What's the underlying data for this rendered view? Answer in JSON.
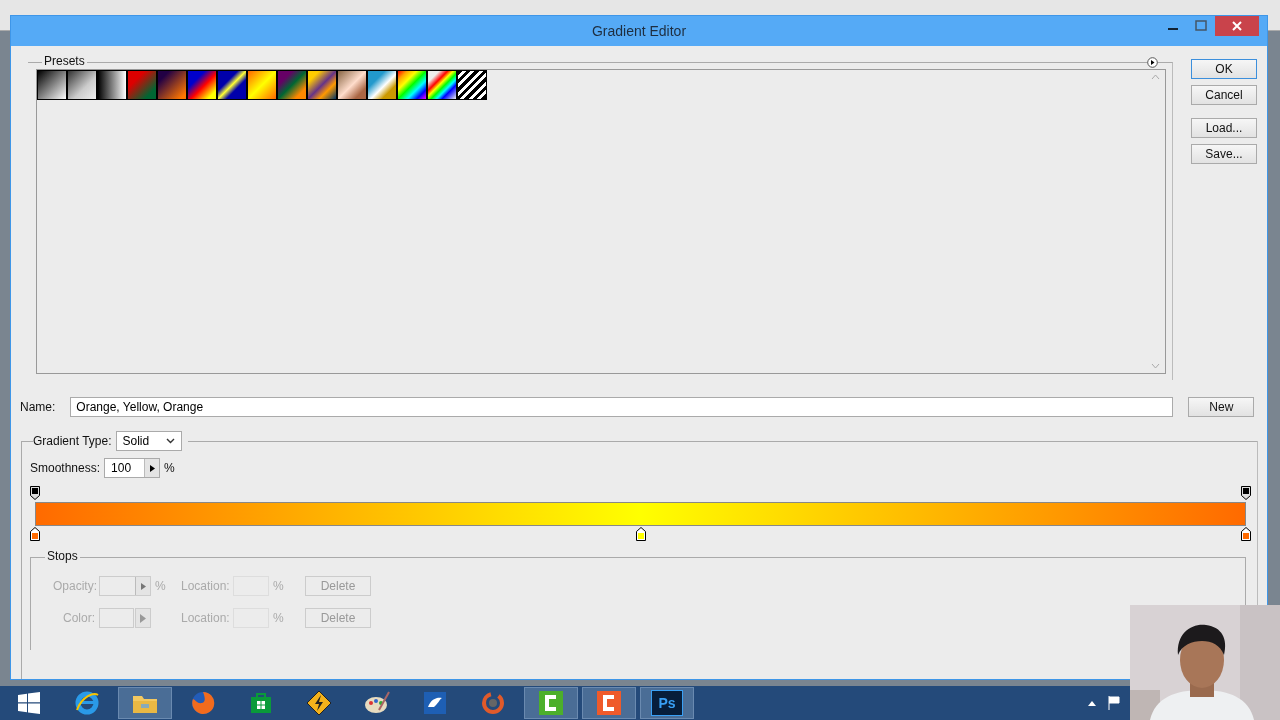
{
  "window": {
    "title": "Gradient Editor"
  },
  "presets": {
    "label": "Presets"
  },
  "buttons": [
    {
      "label": "OK",
      "selected": true
    },
    {
      "label": "Cancel",
      "selected": false
    },
    {
      "label": "Load...",
      "selected": false
    },
    {
      "label": "Save...",
      "selected": false
    }
  ],
  "name": {
    "label": "Name:",
    "value": "Orange, Yellow, Orange",
    "button": "New"
  },
  "gradient_type": {
    "label": "Gradient Type:",
    "value": "Solid"
  },
  "smoothness": {
    "label": "Smoothness:",
    "value": "100",
    "unit": "%"
  },
  "opacity_stops": [
    {
      "selected": false
    },
    {
      "selected": false
    }
  ],
  "color_stops": [
    {
      "color": "#ff6a00",
      "selected": false
    },
    {
      "color": "#ffff00",
      "selected": false
    },
    {
      "color": "#ff6a00",
      "selected": false
    }
  ],
  "stops": {
    "label": "Stops",
    "rows": [
      {
        "label": "Opacity:",
        "unit": "%",
        "location_label": "Location:",
        "location_unit": "%",
        "button": "Delete",
        "disabled": true
      },
      {
        "label": "Color:",
        "unit": null,
        "location_label": "Location:",
        "location_unit": "%",
        "button": "Delete",
        "disabled": true
      }
    ]
  },
  "taskbar": {
    "items": [
      {
        "kind": "start",
        "active": false
      },
      {
        "kind": "browser",
        "active": false
      },
      {
        "kind": "folder",
        "active": true
      },
      {
        "kind": "globe",
        "active": false
      },
      {
        "kind": "store",
        "active": false
      },
      {
        "kind": "bolt",
        "active": false
      },
      {
        "kind": "palette",
        "active": false
      },
      {
        "kind": "bird",
        "active": false
      },
      {
        "kind": "ring",
        "active": false
      },
      {
        "kind": "green",
        "active": true
      },
      {
        "kind": "orange",
        "active": true
      },
      {
        "kind": "ps",
        "label": "Ps",
        "active": true
      }
    ]
  }
}
